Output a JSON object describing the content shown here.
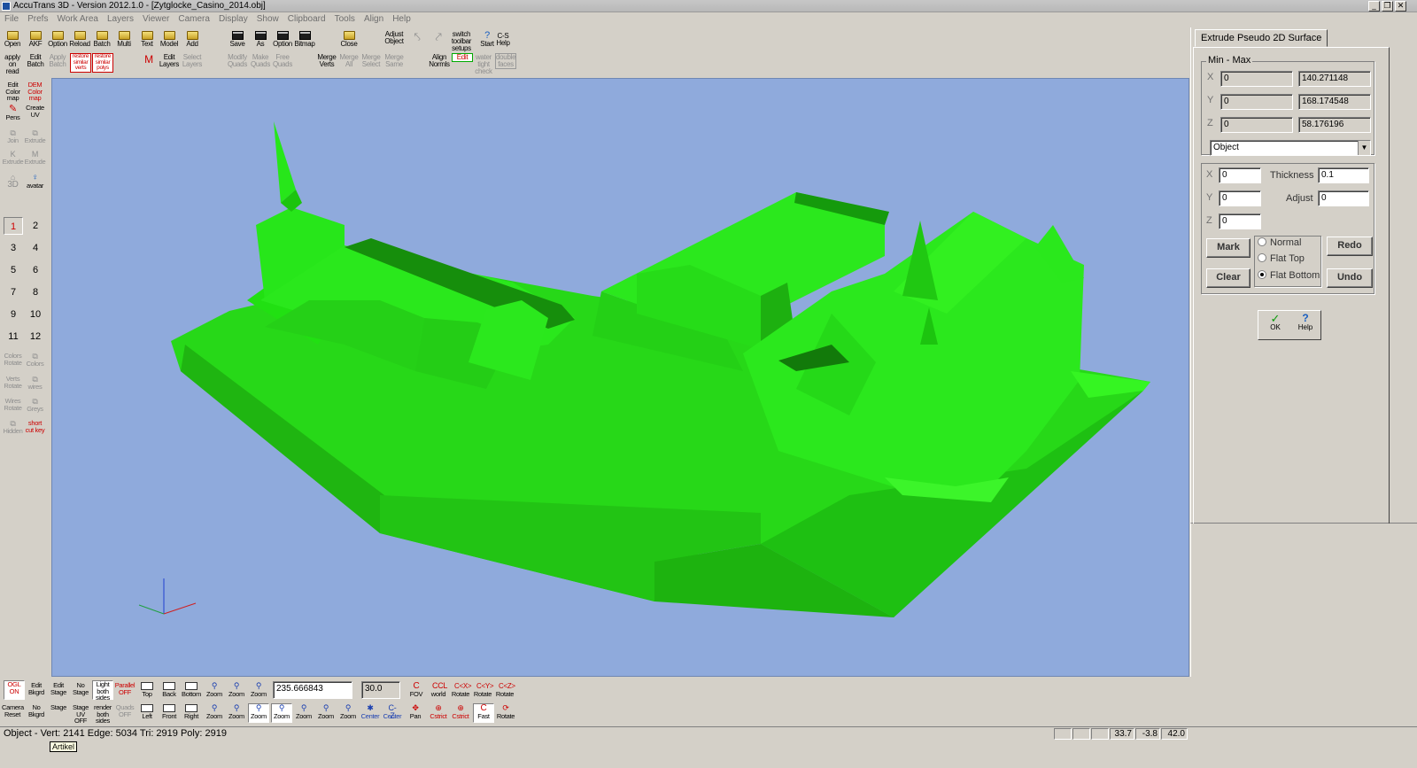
{
  "window": {
    "title": "AccuTrans 3D - Version 2012.1.0 - [Zytglocke_Casino_2014.obj]",
    "min": "_",
    "restore": "❐",
    "close": "✕"
  },
  "menu": [
    "File",
    "Prefs",
    "Work Area",
    "Layers",
    "Viewer",
    "Camera",
    "Display",
    "Show",
    "Clipboard",
    "Tools",
    "Align",
    "Help"
  ],
  "toolbar": {
    "row1": [
      "Open",
      "AKF",
      "Option",
      "Reload",
      "Batch",
      "Multi",
      "Text",
      "Model",
      "Add",
      "Save",
      "As",
      "Option",
      "Bitmap",
      "Close",
      "Adjust Object",
      "",
      "",
      "switch toolbar setups",
      "Start",
      "C-S Help"
    ],
    "row2": [
      "apply on read",
      "Edit Batch",
      "Apply Batch",
      "restore similar verts",
      "restore similar polys",
      "M",
      "Edit Layers",
      "Select Layers",
      "Modify Quads",
      "Make Quads",
      "Free Quads",
      "Merge Verts",
      "Merge All",
      "Merge Select",
      "Merge Same",
      "Align Normls",
      "Edit",
      "water tight check",
      "double faces"
    ]
  },
  "left_tools": [
    "Edit Color map",
    "DEM Color map",
    "Pens",
    "Create UV",
    "Join",
    "Extrude",
    "Extrude",
    "Extrude",
    "3D",
    "avatar",
    "Colors Rotate",
    "Colors",
    "Verts Rotate",
    "wires",
    "Wires Rotate",
    "Greys",
    "Hidden",
    "short cut key"
  ],
  "left_tool_keys": [
    "K",
    "M"
  ],
  "numbers": [
    "1",
    "2",
    "3",
    "4",
    "5",
    "6",
    "7",
    "8",
    "9",
    "10",
    "11",
    "12"
  ],
  "panel": {
    "tab": "Extrude Pseudo 2D Surface",
    "minmax_label": "Min - Max",
    "x_label": "X",
    "y_label": "Y",
    "z_label": "Z",
    "x_min": "0",
    "x_max": "140.271148",
    "y_min": "0",
    "y_max": "168.174548",
    "z_min": "0",
    "z_max": "58.176196",
    "object_select": "Object",
    "ex_x": "0",
    "ex_y": "0",
    "ex_z": "0",
    "thickness_label": "Thickness",
    "thickness": "0.1",
    "adjust_label": "Adjust",
    "adjust": "0",
    "mark": "Mark",
    "clear": "Clear",
    "redo": "Redo",
    "undo": "Undo",
    "radio_normal": "Normal",
    "radio_flattop": "Flat Top",
    "radio_flatbottom": "Flat Bottom",
    "ok": "OK",
    "help": "Help"
  },
  "bottom": {
    "row1": [
      "OGL ON",
      "Edit Bkgrd",
      "Edit Stage",
      "No Stage",
      "Light both sides",
      "Parallel OFF",
      "Top",
      "Back",
      "Bottom",
      "Zoom",
      "Zoom",
      "Zoom",
      "FOV",
      "world",
      "Rotate",
      "Rotate",
      "Rotate"
    ],
    "row2": [
      "Camera Reset",
      "No Bkgrd",
      "Stage",
      "Stage UV OFF",
      "render both sides",
      "Quads OFF",
      "Left",
      "Front",
      "Right",
      "Zoom",
      "Zoom",
      "Zoom",
      "Zoom",
      "Zoom",
      "Zoom",
      "Zoom",
      "Center",
      "Center",
      "Pan",
      "Cstrict",
      "Cstrict",
      "Fast",
      "Rotate"
    ],
    "zoom_value": "235.666843",
    "fov_value": "30.0"
  },
  "status": {
    "text": "Object  -  Vert: 2141  Edge: 5034  Tri: 2919  Poly: 2919",
    "v1": "33.7",
    "v2": "-3.8",
    "v3": "42.0",
    "tooltip": "Artikel"
  },
  "colors": {
    "viewport_bg": "#8faadc",
    "model": "#22e614",
    "chrome": "#d4d0c8"
  }
}
